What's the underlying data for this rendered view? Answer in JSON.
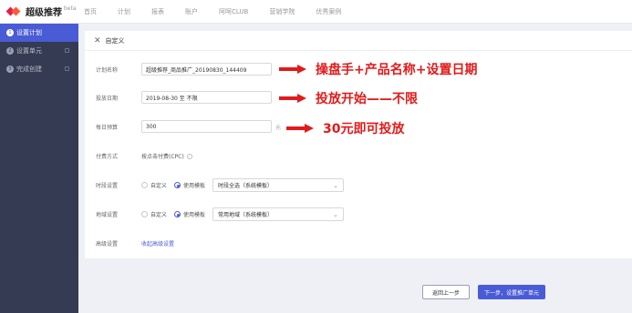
{
  "brand": {
    "name": "超级推荐",
    "beta": "beta"
  },
  "nav": [
    "首页",
    "计划",
    "报表",
    "账户",
    "阿呵CLUB",
    "营销学院",
    "优秀案例"
  ],
  "sidebar": [
    {
      "num": "1",
      "label": "设置计划"
    },
    {
      "num": "2",
      "label": "设置单元"
    },
    {
      "num": "3",
      "label": "完成创建"
    }
  ],
  "panel": {
    "title": "自定义"
  },
  "form": {
    "plan_name_label": "计划名称",
    "plan_name_value": "超级推荐_商品推广_20190830_144409",
    "date_label": "投放日期",
    "date_value": "2019-08-30 至 不限",
    "budget_label": "每日预算",
    "budget_value": "300",
    "budget_unit": "元",
    "pay_label": "付费方式",
    "pay_value": "按点击付费(CPC)",
    "time_label": "时段设置",
    "time_opt_custom": "自定义",
    "time_opt_template": "使用模板",
    "time_select": "时段全选（系统模板）",
    "region_label": "地域设置",
    "region_opt_custom": "自定义",
    "region_opt_template": "使用模板",
    "region_select": "常用地域（系统模板）",
    "advanced_label": "高级设置",
    "advanced_link": "收起高级设置"
  },
  "annotations": {
    "a1": "操盘手+产品名称+设置日期",
    "a2": "投放开始——不限",
    "a3": "30元即可投放"
  },
  "buttons": {
    "prev": "返回上一步",
    "next": "下一步，设置推广单元"
  },
  "colors": {
    "accent": "#4a5bd6",
    "sidebar": "#353b52",
    "annotation": "#e21a1a"
  }
}
